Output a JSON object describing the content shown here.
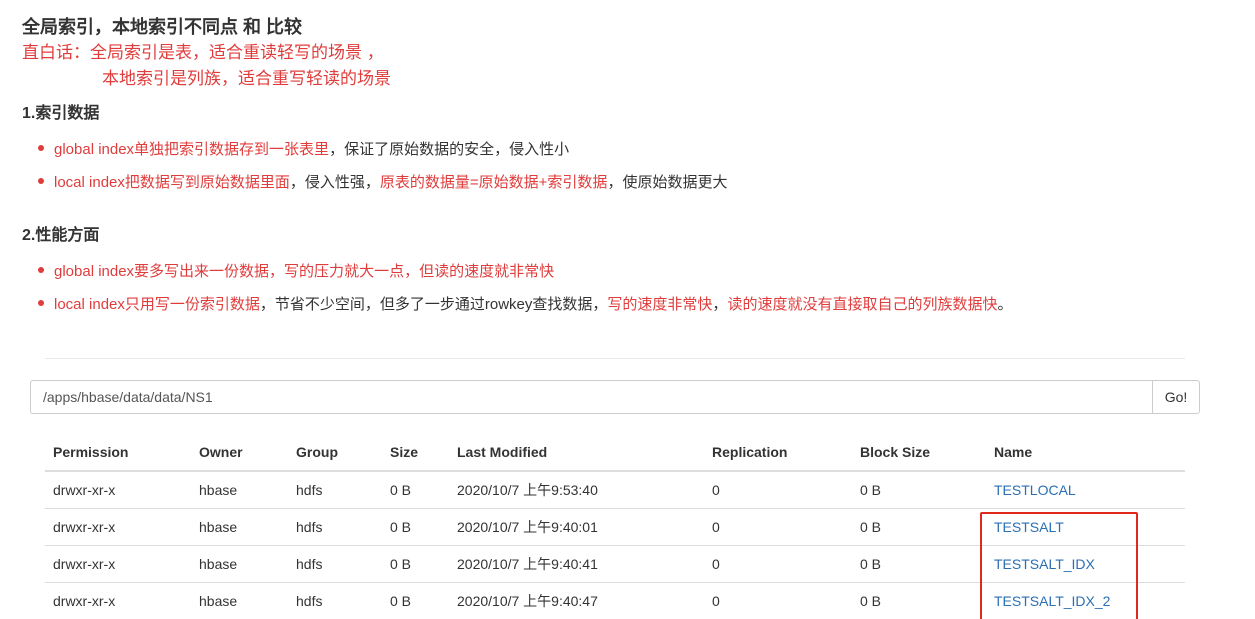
{
  "article": {
    "title": "全局索引，本地索引不同点 和 比较",
    "summary_line1": "直白话：全局索引是表，适合重读轻写的场景 ，",
    "summary_line2": "本地索引是列族，适合重写轻读的场景",
    "section1": {
      "heading": "1.索引数据",
      "bullet1": {
        "red": "global index单独把索引数据存到一张表里",
        "dark": "，保证了原始数据的安全，侵入性小"
      },
      "bullet2": {
        "red1": "local index把数据写到原始数据里面",
        "dark1": "，侵入性强，",
        "red2": "原表的数据量=原始数据+索引数据",
        "dark2": "，使原始数据更大"
      }
    },
    "section2": {
      "heading": "2.性能方面",
      "bullet1": {
        "red": "global index要多写出来一份数据，写的压力就大一点，但读的速度就非常快"
      },
      "bullet2": {
        "red1": "local index只用写一份索引数据",
        "dark1": "，节省不少空间，但多了一步通过rowkey查找数据，",
        "red2": "写的速度非常快",
        "dark2": "，",
        "red3": "读的速度就没有直接取自己的列族数据快",
        "dark3": "。"
      }
    }
  },
  "browser": {
    "path_value": "/apps/hbase/data/data/NS1",
    "go_label": "Go!",
    "columns": [
      "Permission",
      "Owner",
      "Group",
      "Size",
      "Last Modified",
      "Replication",
      "Block Size",
      "Name"
    ],
    "rows": [
      {
        "permission": "drwxr-xr-x",
        "owner": "hbase",
        "group": "hdfs",
        "size": "0 B",
        "modified": "2020/10/7 上午9:53:40",
        "replication": "0",
        "block_size": "0 B",
        "name": "TESTLOCAL"
      },
      {
        "permission": "drwxr-xr-x",
        "owner": "hbase",
        "group": "hdfs",
        "size": "0 B",
        "modified": "2020/10/7 上午9:40:01",
        "replication": "0",
        "block_size": "0 B",
        "name": "TESTSALT"
      },
      {
        "permission": "drwxr-xr-x",
        "owner": "hbase",
        "group": "hdfs",
        "size": "0 B",
        "modified": "2020/10/7 上午9:40:41",
        "replication": "0",
        "block_size": "0 B",
        "name": "TESTSALT_IDX"
      },
      {
        "permission": "drwxr-xr-x",
        "owner": "hbase",
        "group": "hdfs",
        "size": "0 B",
        "modified": "2020/10/7 上午9:40:47",
        "replication": "0",
        "block_size": "0 B",
        "name": "TESTSALT_IDX_2"
      }
    ]
  },
  "colors": {
    "accent_red": "#e03c3c",
    "link_blue": "#2a6fb4",
    "highlight_border": "#e0281e"
  }
}
